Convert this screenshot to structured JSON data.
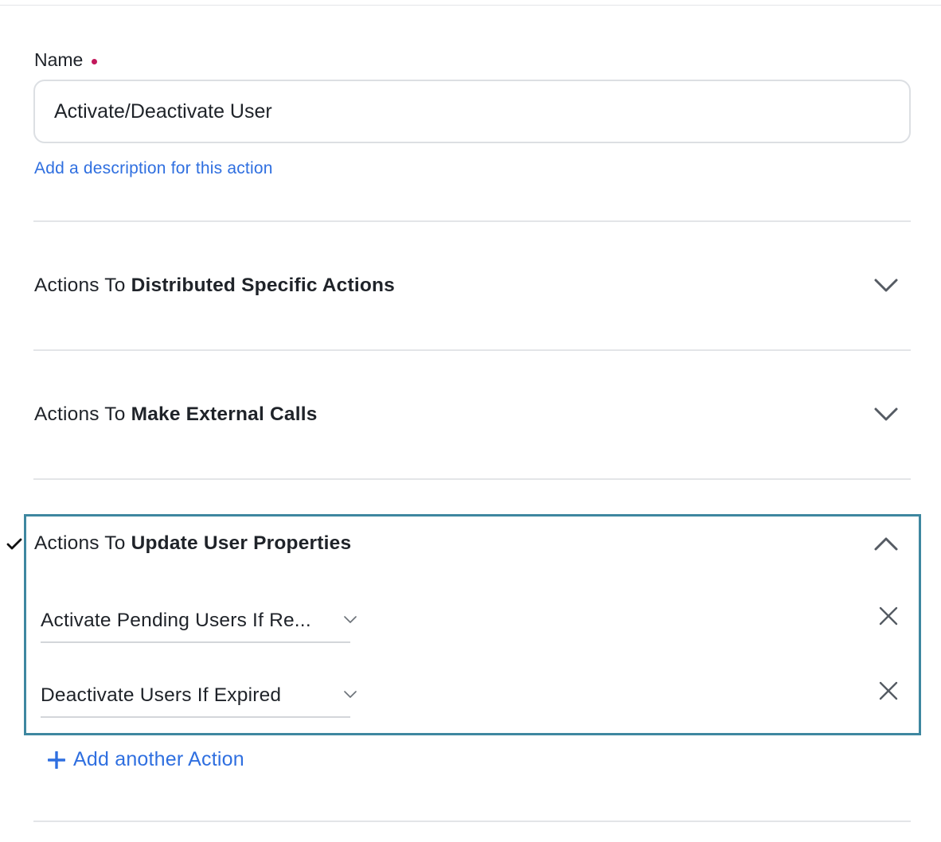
{
  "form": {
    "name_label": "Name",
    "name_value": "Activate/Deactivate User",
    "description_link": "Add a description for this action"
  },
  "sections": [
    {
      "prefix": "Actions To ",
      "title": "Distributed Specific Actions",
      "expanded": false
    },
    {
      "prefix": "Actions To ",
      "title": "Make External Calls",
      "expanded": false
    },
    {
      "prefix": "Actions To ",
      "title": "Update User Properties",
      "expanded": true,
      "completed": true
    }
  ],
  "selected_actions": [
    {
      "label": "Activate Pending Users If Re..."
    },
    {
      "label": "Deactivate Users If Expired"
    }
  ],
  "add_action_label": "Add another Action",
  "icons": {
    "check": "check-icon",
    "chevron_down": "chevron-down-icon",
    "chevron_up": "chevron-up-icon",
    "close": "close-icon",
    "plus": "plus-icon"
  },
  "colors": {
    "accent": "#2f6fe0",
    "focus_border": "#3e87a0",
    "required": "#c2185b"
  }
}
